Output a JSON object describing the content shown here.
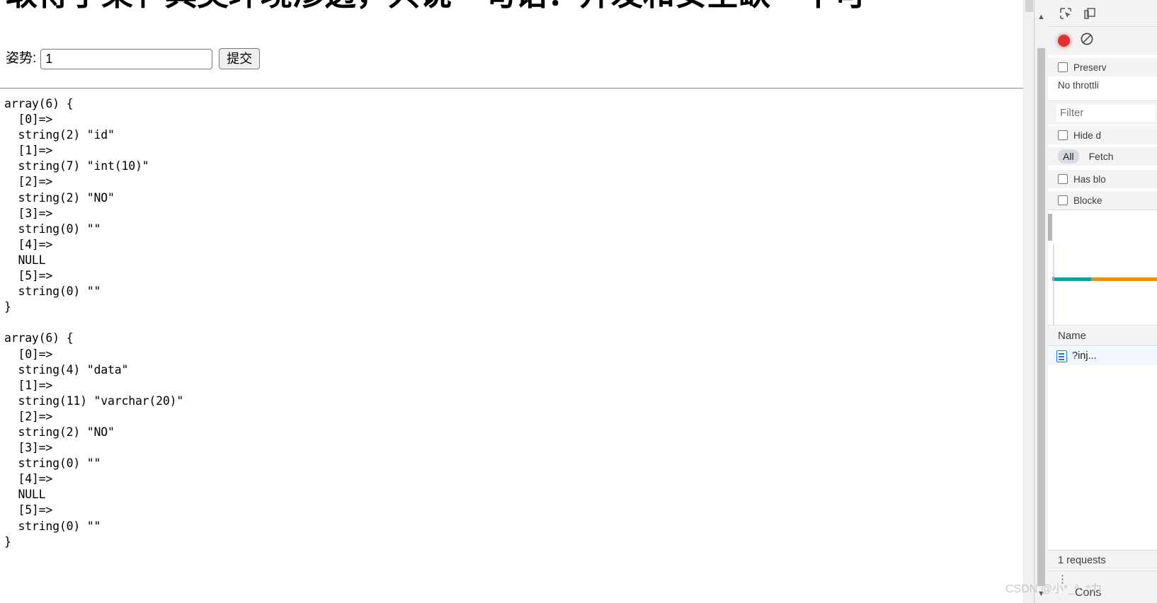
{
  "page": {
    "heading": "取得了某亻具类环境渗透，只说一句话：开发和安全缺一不可",
    "form": {
      "label": "姿势:",
      "input_value": "1",
      "input_placeholder": "",
      "submit_label": "提交"
    },
    "output": "array(6) {\n  [0]=>\n  string(2) \"id\"\n  [1]=>\n  string(7) \"int(10)\"\n  [2]=>\n  string(2) \"NO\"\n  [3]=>\n  string(0) \"\"\n  [4]=>\n  NULL\n  [5]=>\n  string(0) \"\"\n}\n\narray(6) {\n  [0]=>\n  string(4) \"data\"\n  [1]=>\n  string(11) \"varchar(20)\"\n  [2]=>\n  string(2) \"NO\"\n  [3]=>\n  string(0) \"\"\n  [4]=>\n  NULL\n  [5]=>\n  string(0) \"\"\n}"
  },
  "devtools": {
    "toolbar": {
      "inspect_title": "Inspect element",
      "device_title": "Toggle device toolbar"
    },
    "network": {
      "record_title": "Record",
      "clear_title": "Clear",
      "preserve_log_label": "Preserv",
      "throttling_label": "No throttli",
      "filter_placeholder": "Filter",
      "hide_data_urls_label": "Hide d",
      "type_filters": [
        "All",
        "Fetch"
      ],
      "has_blocked_label": "Has blo",
      "blocked_cookies_label": "Blocke",
      "table_columns": [
        "Name"
      ],
      "rows": [
        {
          "name": "?inj...",
          "icon": "document-icon"
        }
      ],
      "status": "1 requests"
    },
    "drawer": {
      "tab_label": "Cons",
      "menu_label": "⋮"
    },
    "colors": {
      "record_red": "#e03131",
      "overview_teal": "#12a19a",
      "overview_orange": "#e8920c",
      "doc_icon_blue": "#1a73e8",
      "row_selected_bg": "#f2f7fd"
    }
  },
  "watermark": {
    "text": "CSDN @小*_^_*力"
  }
}
